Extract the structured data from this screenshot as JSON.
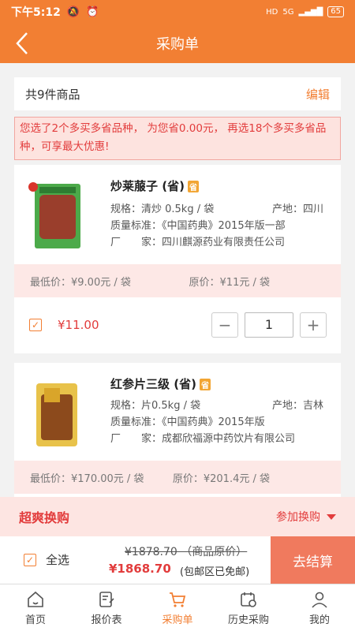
{
  "status": {
    "time": "下午5:12",
    "battery": "65",
    "network": "5G",
    "hd": "HD"
  },
  "nav": {
    "title": "采购单"
  },
  "summary": {
    "count_text": "共9件商品",
    "edit_label": "编辑"
  },
  "notice": {
    "text": "您选了2个多买多省品种， 为您省0.00元， 再选18个多买多省品种，可享最大优惠!"
  },
  "products": [
    {
      "name": "炒莱菔子 (省)",
      "badge": "省",
      "spec": "规格：清炒 0.5kg / 袋",
      "origin": "产地：四川",
      "standard": "质量标准：《中国药典》2015年版一部",
      "maker": "厂　　家：四川麒源药业有限责任公司",
      "min_price": "最低价：¥9.00元 / 袋",
      "orig_price": "原价：¥11元 / 袋",
      "price": "¥11.00",
      "qty": "1",
      "minus": "−",
      "plus": "+"
    },
    {
      "name": "红参片三级 (省)",
      "badge": "省",
      "spec": "规格：片0.5kg / 袋",
      "origin": "产地：吉林",
      "standard": "质量标准：《中国药典》2015年版",
      "maker": "厂　　家：成都欣福源中药饮片有限公司",
      "min_price": "最低价：¥170.00元 / 袋",
      "orig_price": "原价：¥201.4元 / 袋"
    }
  ],
  "exchange": {
    "title": "超爽换购",
    "join_label": "参加换购"
  },
  "checkout": {
    "select_all": "全选",
    "orig_total": "¥1878.70 （商品原价）",
    "total": "¥1868.70",
    "free_shipping": "(包邮区已免邮)",
    "settle_label": "去结算"
  },
  "tabs": [
    {
      "label": "首页"
    },
    {
      "label": "报价表"
    },
    {
      "label": "采购单"
    },
    {
      "label": "历史采购"
    },
    {
      "label": "我的"
    }
  ],
  "colors": {
    "accent": "#f27f33",
    "red": "#e23c3c",
    "settle": "#f07a5e"
  }
}
